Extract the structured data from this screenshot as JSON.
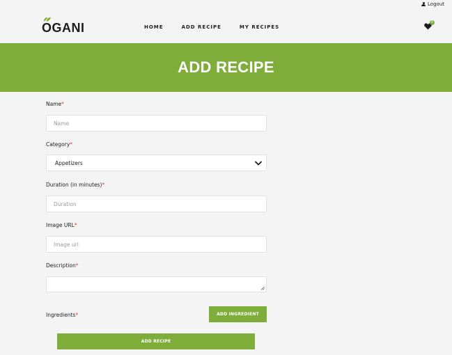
{
  "header": {
    "logout_label": "Logout",
    "logo_text": "OGANI",
    "nav": [
      {
        "label": "HOME"
      },
      {
        "label": "ADD RECIPE"
      },
      {
        "label": "MY RECIPES"
      }
    ],
    "favorites_count": "0"
  },
  "hero": {
    "title": "ADD RECIPE"
  },
  "form": {
    "name": {
      "label": "Name",
      "placeholder": "Name"
    },
    "category": {
      "label": "Category",
      "selected": "Appetizers"
    },
    "duration": {
      "label": "Duration (in minutes)",
      "placeholder": "Duration"
    },
    "image_url": {
      "label": "Image URL",
      "placeholder": "Image url"
    },
    "description": {
      "label": "Description",
      "placeholder": ""
    },
    "ingredients": {
      "label": "Ingredients",
      "add_button": "ADD INGREDIENT"
    },
    "required_mark": "*",
    "submit_button": "ADD RECIPE"
  },
  "colors": {
    "accent": "#7fad39",
    "required": "#e53637",
    "background": "#f4f4f4"
  }
}
